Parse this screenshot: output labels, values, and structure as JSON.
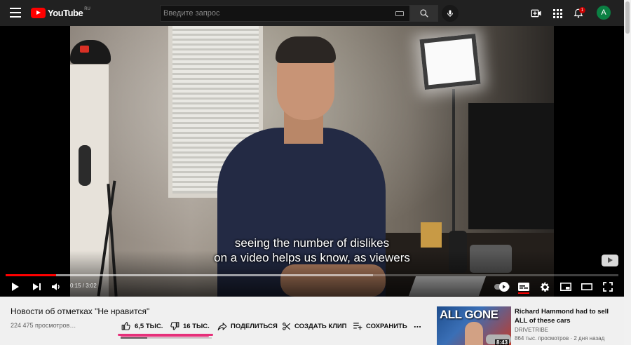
{
  "header": {
    "logo_text": "YouTube",
    "region": "RU",
    "search_placeholder": "Введите запрос",
    "notification_count": "1",
    "avatar_letter": "A"
  },
  "player": {
    "subtitle_line1": "seeing the number of dislikes",
    "subtitle_line2": "on a video helps us know, as viewers",
    "time_display": "0:15 / 3:02",
    "progress_fraction": 0.082,
    "buffered_fraction": 0.6,
    "accent_color": "#ff0000"
  },
  "video": {
    "title": "Новости об отметках \"Не нравится\"",
    "views": "224 475 просмотров…",
    "like_count": "6,5 ТЫС.",
    "dislike_count": "16 ТЫС.",
    "share_label": "ПОДЕЛИТЬСЯ",
    "clip_label": "СОЗДАТЬ КЛИП",
    "save_label": "СОХРАНИТЬ",
    "more_label": "...",
    "highlight_color": "#e6307a",
    "like_fraction": 0.29
  },
  "recommendation": {
    "thumb_text": "ALL GONE",
    "duration": "8:43",
    "title": "Richard Hammond had to sell ALL of these cars",
    "channel": "DRIVETRIBE",
    "meta": "864 тыс. просмотров · 2 дня назад"
  },
  "icons": {
    "menu": "hamburger-icon",
    "search": "search-icon",
    "mic": "mic-icon",
    "create": "create-video-icon",
    "apps": "apps-grid-icon",
    "notifications": "bell-icon",
    "like": "thumbs-up-icon",
    "dislike": "thumbs-down-icon",
    "share": "share-arrow-icon",
    "clip": "scissors-icon",
    "save": "playlist-add-icon"
  }
}
